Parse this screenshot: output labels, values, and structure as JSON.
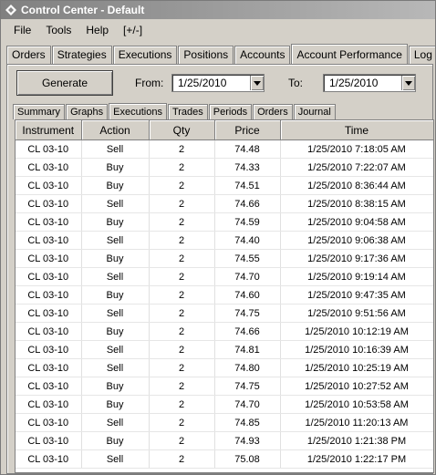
{
  "window": {
    "title": "Control Center - Default"
  },
  "menu": [
    "File",
    "Tools",
    "Help",
    "[+/-]"
  ],
  "top_tabs": [
    "Orders",
    "Strategies",
    "Executions",
    "Positions",
    "Accounts",
    "Account Performance",
    "Log"
  ],
  "active_top_tab": "Account Performance",
  "toolbar": {
    "generate_label": "Generate",
    "from_label": "From:",
    "from_value": "1/25/2010",
    "to_label": "To:",
    "to_value": "1/25/2010"
  },
  "sub_tabs": [
    "Summary",
    "Graphs",
    "Executions",
    "Trades",
    "Periods",
    "Orders",
    "Journal"
  ],
  "active_sub_tab": "Executions",
  "table": {
    "columns": [
      "Instrument",
      "Action",
      "Qty",
      "Price",
      "Time"
    ],
    "rows": [
      [
        "CL 03-10",
        "Sell",
        "2",
        "74.48",
        "1/25/2010 7:18:05 AM"
      ],
      [
        "CL 03-10",
        "Buy",
        "2",
        "74.33",
        "1/25/2010 7:22:07 AM"
      ],
      [
        "CL 03-10",
        "Buy",
        "2",
        "74.51",
        "1/25/2010 8:36:44 AM"
      ],
      [
        "CL 03-10",
        "Sell",
        "2",
        "74.66",
        "1/25/2010 8:38:15 AM"
      ],
      [
        "CL 03-10",
        "Buy",
        "2",
        "74.59",
        "1/25/2010 9:04:58 AM"
      ],
      [
        "CL 03-10",
        "Sell",
        "2",
        "74.40",
        "1/25/2010 9:06:38 AM"
      ],
      [
        "CL 03-10",
        "Buy",
        "2",
        "74.55",
        "1/25/2010 9:17:36 AM"
      ],
      [
        "CL 03-10",
        "Sell",
        "2",
        "74.70",
        "1/25/2010 9:19:14 AM"
      ],
      [
        "CL 03-10",
        "Buy",
        "2",
        "74.60",
        "1/25/2010 9:47:35 AM"
      ],
      [
        "CL 03-10",
        "Sell",
        "2",
        "74.75",
        "1/25/2010 9:51:56 AM"
      ],
      [
        "CL 03-10",
        "Buy",
        "2",
        "74.66",
        "1/25/2010 10:12:19 AM"
      ],
      [
        "CL 03-10",
        "Sell",
        "2",
        "74.81",
        "1/25/2010 10:16:39 AM"
      ],
      [
        "CL 03-10",
        "Sell",
        "2",
        "74.80",
        "1/25/2010 10:25:19 AM"
      ],
      [
        "CL 03-10",
        "Buy",
        "2",
        "74.75",
        "1/25/2010 10:27:52 AM"
      ],
      [
        "CL 03-10",
        "Buy",
        "2",
        "74.70",
        "1/25/2010 10:53:58 AM"
      ],
      [
        "CL 03-10",
        "Sell",
        "2",
        "74.85",
        "1/25/2010 11:20:13 AM"
      ],
      [
        "CL 03-10",
        "Buy",
        "2",
        "74.93",
        "1/25/2010 1:21:38 PM"
      ],
      [
        "CL 03-10",
        "Sell",
        "2",
        "75.08",
        "1/25/2010 1:22:17 PM"
      ]
    ]
  }
}
